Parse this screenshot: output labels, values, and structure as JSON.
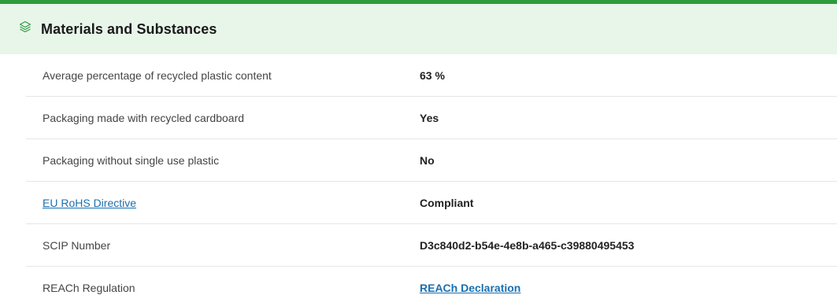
{
  "section": {
    "title": "Materials and Substances",
    "icon": "layers-icon",
    "accent_color": "#2e9b3c",
    "header_bg": "#e8f6ea"
  },
  "rows": [
    {
      "label": "Average percentage of recycled plastic content",
      "value": "63 %"
    },
    {
      "label": "Packaging made with recycled cardboard",
      "value": "Yes"
    },
    {
      "label": "Packaging without single use plastic",
      "value": "No"
    },
    {
      "label": "EU RoHS Directive",
      "value": "Compliant"
    },
    {
      "label": "SCIP Number",
      "value": "D3c840d2-b54e-4e8b-a465-c39880495453"
    },
    {
      "label": "REACh Regulation",
      "value": "REACh Declaration"
    }
  ],
  "link_color": "#1a6fb0"
}
